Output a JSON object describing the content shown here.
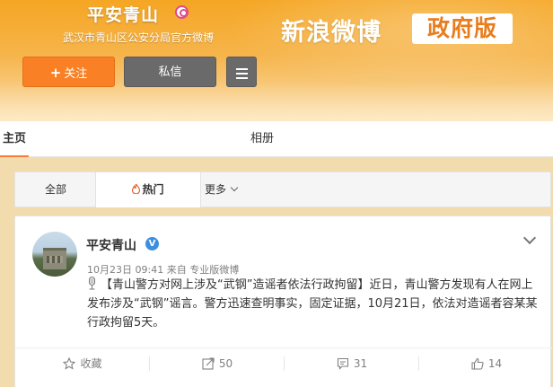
{
  "header": {
    "account_name": "平安青山",
    "account_desc": "武汉市青山区公安分局官方微博",
    "brand_text": "新浪微博",
    "brand_badge": "政府版",
    "follow_label": "关注",
    "follow_icon": "plus-icon",
    "message_label": "私信",
    "menu_icon": "hamburger-menu-icon",
    "verified_icon": "verified-badge-icon"
  },
  "tabs": {
    "main": "主页",
    "album": "相册"
  },
  "filters": {
    "all": "全部",
    "hot": "热门",
    "more": "更多",
    "hot_icon": "flame-icon",
    "more_icon": "chevron-down-icon"
  },
  "post": {
    "author": "平安青山",
    "verified_mark": "V",
    "time": "10月23日 09:41",
    "source_prefix": "来自",
    "source": "专业版微博",
    "text_bracket_title": "【青山警方对网上涉及“武钢”造谣者依法行政拘留】",
    "text_body": "近日，青山警方发现有人在网上发布涉及“武钢”谣言。警方迅速查明事实，固定证据，10月21日，依法对造谣者容某某行政拘留5天。",
    "actions": {
      "favorite_label": "收藏",
      "repost_count": "50",
      "comment_count": "31",
      "like_count": "14"
    }
  },
  "colors": {
    "banner_orange": "#f5a623",
    "follow_button": "#f98024",
    "dark_button": "#6a6a6a",
    "tab_underline": "#fa7d3c",
    "verified_blue": "#3c8fe0",
    "page_background": "#f2dcae"
  }
}
